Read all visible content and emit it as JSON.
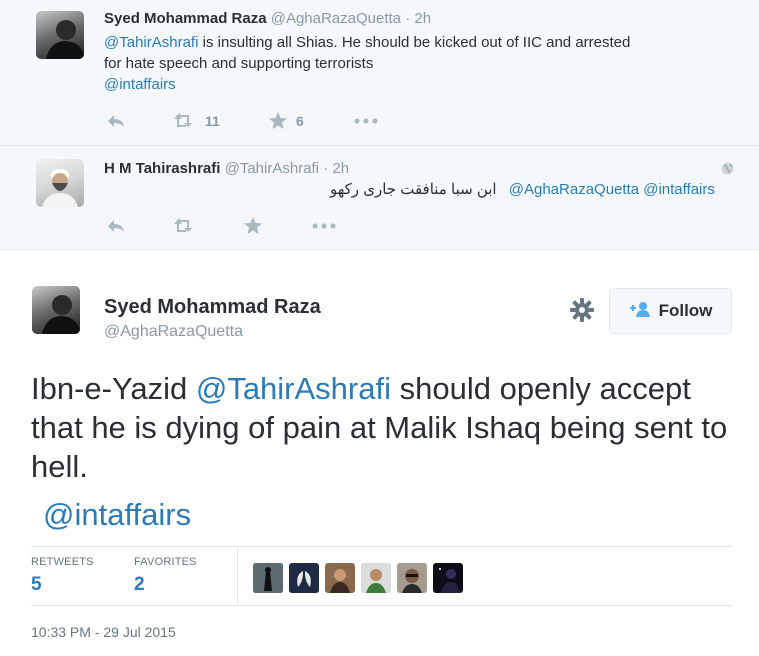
{
  "reply1": {
    "fullname": "Syed Mohammad Raza",
    "screenname": "@AghaRazaQuetta",
    "dot": "·",
    "time": "2h",
    "line1_mention": "@TahirAshrafi",
    "line1_text": " is insulting all Shias. He should be kicked out of IIC and arrested",
    "line2_text": "for hate speech and supporting terrorists",
    "line3_mention": "@intaffairs",
    "actions": {
      "retweet_count": "11",
      "favorite_count": "6"
    },
    "icons": [
      "reply-icon",
      "retweet-icon",
      "star-icon",
      "more-icon"
    ]
  },
  "reply2": {
    "fullname": "H M Tahirashrafi",
    "screenname": "@TahirAshrafi",
    "dot": "·",
    "time": "2h",
    "mentions": "@AghaRazaQuetta @intaffairs",
    "urdu_text": "ابن سبا  منافقت جاری رکھو",
    "icons": [
      "reply-icon",
      "retweet-icon",
      "star-icon",
      "more-icon",
      "globe-icon"
    ]
  },
  "main_tweet": {
    "fullname": "Syed Mohammad Raza",
    "screenname": "@AghaRazaQuetta",
    "follow_label": "Follow",
    "text_part1": "Ibn-e-Yazid ",
    "text_mention": "@TahirAshrafi",
    "text_part2": " should openly accept that he is dying of pain at Malik Ishaq being sent to hell.",
    "text_mention2": "@intaffairs",
    "stats": {
      "retweets_label": "RETWEETS",
      "retweets_value": "5",
      "favorites_label": "FAVORITES",
      "favorites_value": "2"
    },
    "timestamp": "10:33 PM - 29 Jul 2015",
    "colors": {
      "link": "#2b7bb9",
      "muted": "#8899a6",
      "text": "#292f33",
      "background_light": "#f5f8fa"
    }
  }
}
